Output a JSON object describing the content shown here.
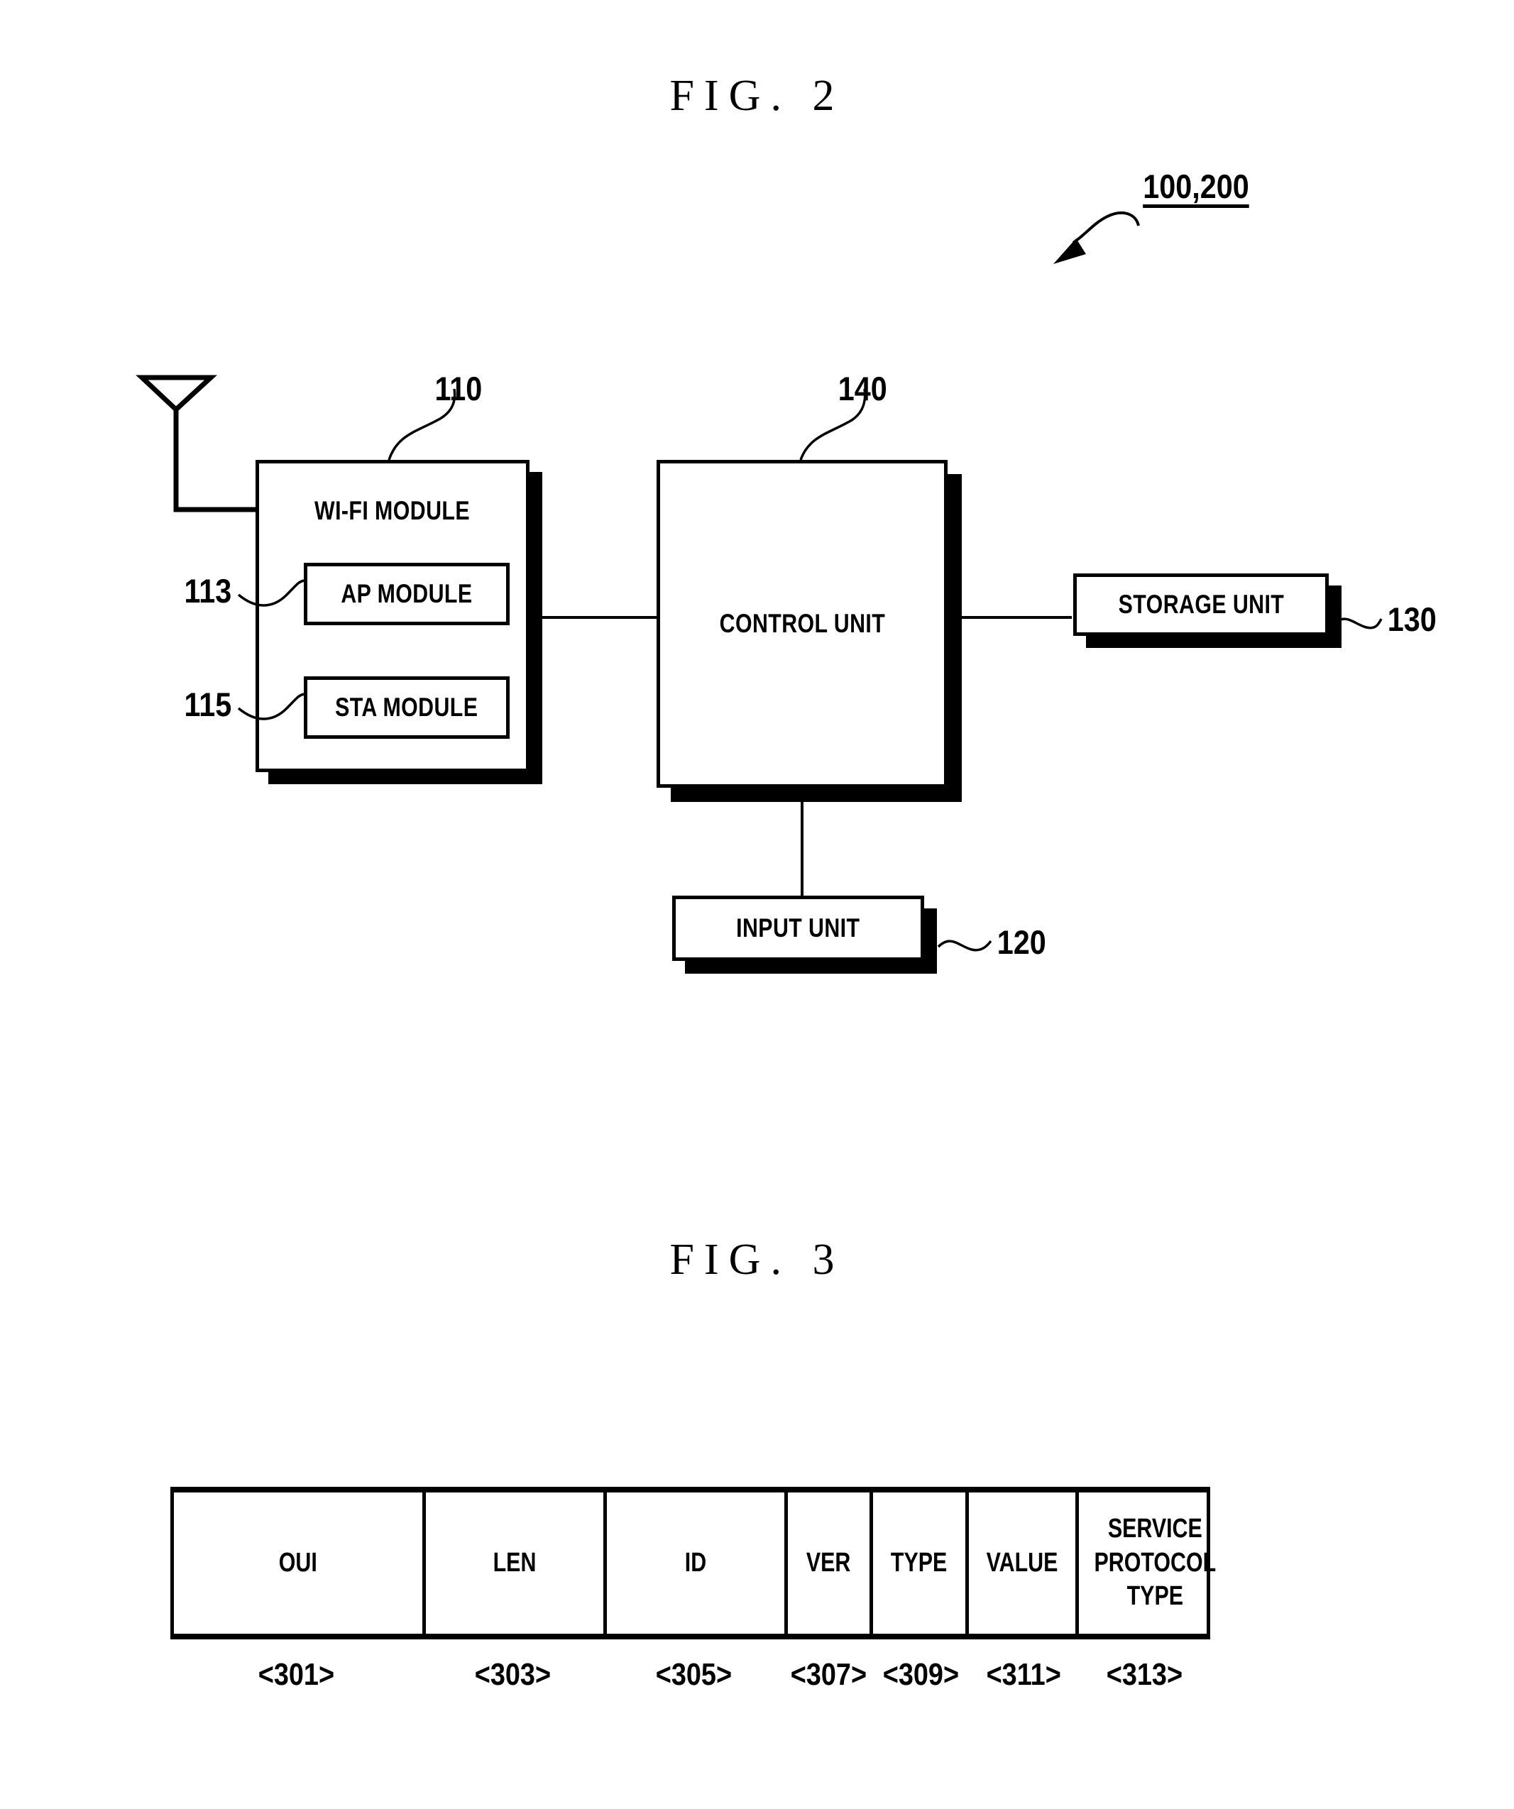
{
  "figures": {
    "fig2": {
      "title": "FIG. 2",
      "device_ref": "100,200",
      "blocks": {
        "wifi_module": {
          "label": "WI-FI MODULE",
          "ref": "110"
        },
        "ap_module": {
          "label": "AP MODULE",
          "ref": "113"
        },
        "sta_module": {
          "label": "STA MODULE",
          "ref": "115"
        },
        "control_unit": {
          "label": "CONTROL UNIT",
          "ref": "140"
        },
        "storage_unit": {
          "label": "STORAGE UNIT",
          "ref": "130"
        },
        "input_unit": {
          "label": "INPUT UNIT",
          "ref": "120"
        }
      },
      "antenna": "antenna-icon"
    },
    "fig3": {
      "title": "FIG. 3",
      "table": {
        "columns": [
          {
            "header": "OUI",
            "ref": "<301>"
          },
          {
            "header": "LEN",
            "ref": "<303>"
          },
          {
            "header": "ID",
            "ref": "<305>"
          },
          {
            "header": "VER",
            "ref": "<307>"
          },
          {
            "header": "TYPE",
            "ref": "<309>"
          },
          {
            "header": "VALUE",
            "ref": "<311>"
          },
          {
            "header": "SERVICE\nPROTOCOL\nTYPE",
            "ref": "<313>"
          }
        ]
      }
    }
  },
  "colors": {
    "ink": "#000000",
    "paper": "#ffffff"
  }
}
